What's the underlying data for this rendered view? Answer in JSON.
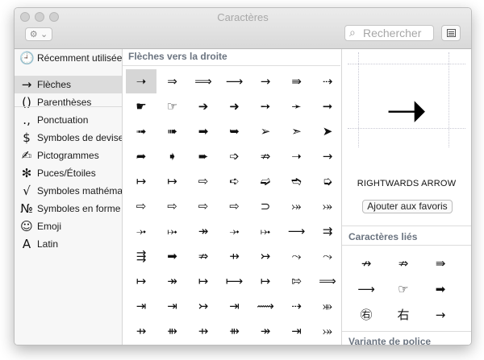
{
  "window": {
    "title": "Caractères"
  },
  "toolbar": {
    "gear_glyph": "⚙ ⌄",
    "search_placeholder": "Rechercher",
    "search_value": ""
  },
  "sidebar": {
    "items": [
      {
        "icon": "🕘",
        "icon_name": "clock-icon",
        "label": "Récemment utilisées",
        "selected": false
      },
      {
        "icon": "→",
        "icon_name": "arrow-icon",
        "label": "Flèches",
        "selected": true
      },
      {
        "icon": "()",
        "icon_name": "parentheses-icon",
        "label": "Parenthèses",
        "selected": false
      },
      {
        "icon": "․,",
        "icon_name": "punctuation-icon",
        "label": "Ponctuation",
        "selected": false
      },
      {
        "icon": "$",
        "icon_name": "dollar-icon",
        "label": "Symboles de devises",
        "selected": false
      },
      {
        "icon": "✍",
        "icon_name": "pictogram-icon",
        "label": "Pictogrammes",
        "selected": false
      },
      {
        "icon": "✻",
        "icon_name": "star-bullet-icon",
        "label": "Puces/Étoiles",
        "selected": false
      },
      {
        "icon": "√",
        "icon_name": "square-root-icon",
        "label": "Symboles mathématiques",
        "selected": false
      },
      {
        "icon": "№",
        "icon_name": "numero-icon",
        "label": "Symboles en forme de lettres",
        "selected": false
      },
      {
        "icon": "☺",
        "icon_name": "smiley-icon",
        "label": "Emoji",
        "selected": false
      },
      {
        "icon": "A",
        "icon_name": "latin-icon",
        "label": "Latin",
        "selected": false
      }
    ]
  },
  "grid": {
    "header": "Flèches vers la droite",
    "selected_index": 0,
    "chars": [
      "➝",
      "⇒",
      "⟹",
      "⟶",
      "→",
      "⇛",
      "⇢",
      "☛",
      "☞",
      "➔",
      "➜",
      "➙",
      "➛",
      "➞",
      "➟",
      "➠",
      "➡",
      "➥",
      "➢",
      "➣",
      "➤",
      "➦",
      "➧",
      "➨",
      "➩",
      "⇏",
      "➝",
      "→",
      "↦",
      "↦",
      "⇨",
      "➪",
      "➫",
      "➬",
      "➭",
      "⇨",
      "⇨",
      "⇨",
      "⇨",
      "⊃",
      "⤖",
      "⤖",
      "⤞",
      "⤠",
      "↠",
      "⤞",
      "⤠",
      "⟶",
      "⇉",
      "⇶",
      "➡",
      "⇏",
      "⇸",
      "↣",
      "⤳",
      "⤳",
      "↦",
      "↠",
      "↦",
      "⟼",
      "↦",
      "⇰",
      "⟹",
      "⇥",
      "⇥",
      "↣",
      "⇥",
      "⟿",
      "⇢",
      "⤕",
      "⇸",
      "⇻",
      "⇸",
      "⇻",
      "↠",
      "⇥",
      "⤖"
    ]
  },
  "details": {
    "preview_glyph": "➝",
    "char_name": "RIGHTWARDS ARROW",
    "favorite_button": "Ajouter aux favoris",
    "related_title": "Caractères liés",
    "related": [
      "↛",
      "⇏",
      "⇛",
      "⟶",
      "☞",
      "➡",
      "㊨",
      "右",
      "→"
    ],
    "font_variation_title": "Variante de police"
  }
}
